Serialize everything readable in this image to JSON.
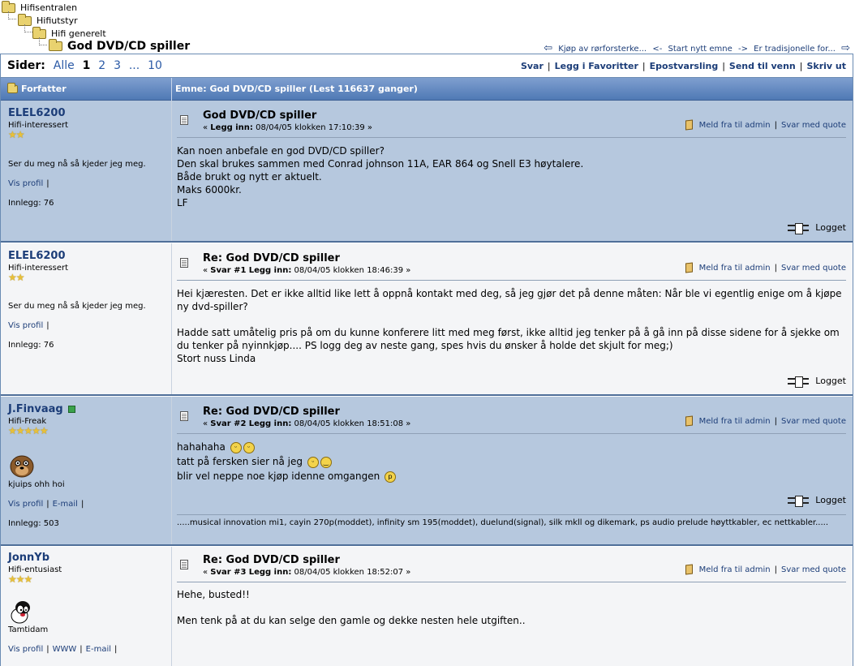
{
  "breadcrumb": {
    "items": [
      "Hifisentralen",
      "Hifiutstyr",
      "Hifi generelt",
      "God DVD/CD spiller"
    ]
  },
  "topnav": {
    "prev_label": "Kjøp av rørforsterke...",
    "new_label": "Start nytt emne",
    "next_label": "Er tradisjonelle for..."
  },
  "pages": {
    "label": "Sider:",
    "all": "Alle",
    "current": "1",
    "p2": "2",
    "p3": "3",
    "ellipsis": "...",
    "last": "10"
  },
  "actions": [
    "Svar",
    "Legg i Favoritter",
    "Epostvarsling",
    "Send til venn",
    "Skriv ut"
  ],
  "header": {
    "author_col": "Forfatter",
    "subject_col": "Emne: God DVD/CD spiller  (Lest 116637 ganger)"
  },
  "common": {
    "report": "Meld fra til admin",
    "quote": "Svar med quote",
    "logged": "Logget",
    "profile": "Vis profil",
    "email": "E-mail",
    "www": "WWW",
    "posted": "Legg inn:"
  },
  "posts": [
    {
      "author": "ELEL6200",
      "rank": "Hifi-interessert",
      "stars": "★★",
      "personal_text": "Ser du meg nå så kjeder jeg meg.",
      "post_count": "Innlegg: 76",
      "title": "God DVD/CD spiller",
      "reply_no": "",
      "date": "08/04/05 klokken 17:10:39",
      "body": [
        "Kan noen anbefale en god DVD/CD spiller?",
        "Den skal brukes sammen med Conrad johnson 11A, EAR 864 og Snell E3 høytalere.",
        "Både brukt og nytt er aktuelt.",
        "Maks 6000kr.",
        "LF"
      ]
    },
    {
      "author": "ELEL6200",
      "rank": "Hifi-interessert",
      "stars": "★★",
      "personal_text": "Ser du meg nå så kjeder jeg meg.",
      "post_count": "Innlegg: 76",
      "title": "Re: God DVD/CD spiller",
      "reply_no": "Svar #1",
      "date": "08/04/05 klokken 18:46:39",
      "body": [
        "Hei kjæresten. Det er ikke alltid like lett å oppnå kontakt med deg, så jeg gjør det på denne måten: Når ble vi egentlig enige om å kjøpe ny dvd-spiller?",
        "",
        "Hadde satt umåtelig pris på om du kunne konferere litt med meg først, ikke alltid jeg tenker på å gå inn på disse sidene for å sjekke om du tenker på nyinnkjøp.... PS logg deg av neste gang, spes hvis du ønsker å holde det skjult for meg;)",
        "Stort nuss Linda"
      ]
    },
    {
      "author": "J.Finvaag",
      "rank": "Hifi-Freak",
      "stars": "★★★★★",
      "personal_text": "kjuips ohh hoi",
      "post_count": "Innlegg: 503",
      "title": "Re: God DVD/CD spiller",
      "reply_no": "Svar #2",
      "date": "08/04/05 klokken 18:51:08",
      "body": [
        "hahahaha",
        "tatt på fersken sier nå jeg",
        "blir vel neppe noe kjøp idenne omgangen"
      ],
      "signature": ".....musical innovation mi1, cayin 270p(moddet), infinity sm 195(moddet), duelund(signal), silk mkll og dikemark, ps audio prelude høyttkabler, ec nettkabler....."
    },
    {
      "author": "JonnYb",
      "rank": "Hifi-entusiast",
      "stars": "★★★",
      "personal_text": "Tamtidam",
      "title": "Re: God DVD/CD spiller",
      "reply_no": "Svar #3",
      "date": "08/04/05 klokken 18:52:07",
      "body": [
        "Hehe, busted!!",
        "",
        "Men tenk på at du kan selge den gamle og dekke nesten hele utgiften.."
      ]
    }
  ],
  "colors": {
    "link": "#1c3d78",
    "header_bg": "#5a82bd",
    "post_blue": "#b6c8de",
    "post_white": "#f4f5f7"
  }
}
